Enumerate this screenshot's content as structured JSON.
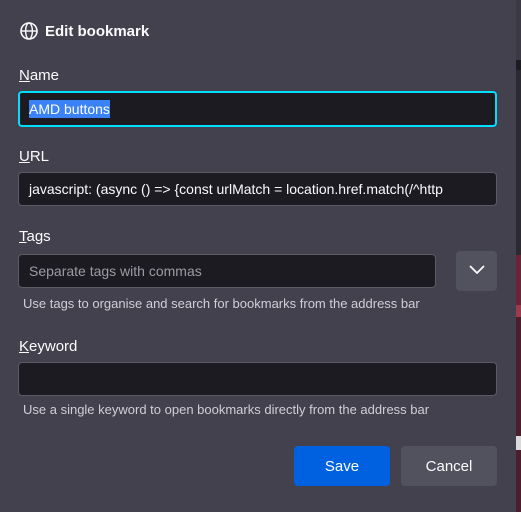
{
  "dialog": {
    "title": "Edit bookmark",
    "title_icon": "globe-icon"
  },
  "name": {
    "label_accel": "N",
    "label_rest": "ame",
    "value": "AMD buttons"
  },
  "url": {
    "label_accel": "U",
    "label_rest": "RL",
    "value": "javascript: (async () => {const urlMatch = location.href.match(/^http"
  },
  "tags": {
    "label_accel": "T",
    "label_rest": "ags",
    "placeholder": "Separate tags with commas",
    "dropdown_icon": "chevron-down-icon",
    "help": "Use tags to organise and search for bookmarks from the address bar"
  },
  "keyword": {
    "label_accel": "K",
    "label_rest": "eyword",
    "value": "",
    "help": "Use a single keyword to open bookmarks directly from the address bar"
  },
  "buttons": {
    "save": "Save",
    "cancel": "Cancel"
  },
  "colors": {
    "panel_bg": "#42414d",
    "field_bg": "#1c1b22",
    "focus_ring": "#00ddff",
    "primary": "#0061e0",
    "selection": "#3b82f6"
  }
}
